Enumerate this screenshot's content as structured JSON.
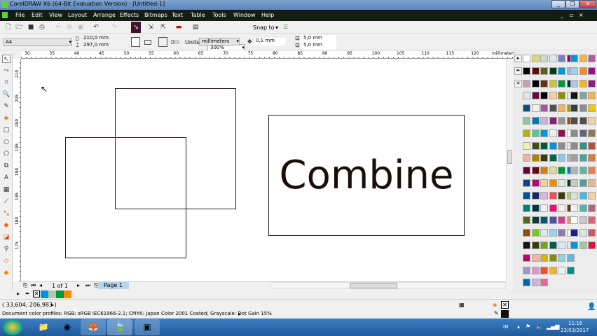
{
  "window": {
    "title": "CorelDRAW X6 (64-Bit Evaluation Version) - [Untitled-1]"
  },
  "menu": [
    "File",
    "Edit",
    "View",
    "Layout",
    "Arrange",
    "Effects",
    "Bitmaps",
    "Text",
    "Table",
    "Tools",
    "Window",
    "Help"
  ],
  "toolbar": {
    "zoom": "300%",
    "snap_to": "Snap to"
  },
  "property_bar": {
    "page_size": "A4",
    "width": "210,0 mm",
    "height": "297,0 mm",
    "units_label": "Units:",
    "units": "millimeters",
    "nudge": "0,1 mm",
    "dup_x": "5,0 mm",
    "dup_y": "5,0 mm"
  },
  "ruler": {
    "h_labels": [
      "30",
      "35",
      "40",
      "45",
      "50",
      "55",
      "60",
      "65",
      "70",
      "75",
      "80",
      "85",
      "90",
      "95",
      "100",
      "105",
      "110",
      "115",
      "120"
    ],
    "unit": "millimeters",
    "v_labels": [
      "210",
      "205",
      "200",
      "195",
      "190",
      "185",
      "180",
      "175"
    ]
  },
  "canvas": {
    "text": "Combine"
  },
  "page_nav": {
    "count": "1 of 1",
    "tab": "Page 1"
  },
  "doc_palette": [
    "#0096dc",
    "#b4c8a0",
    "#00963c",
    "#f08c00"
  ],
  "palette": [
    "#ffffff",
    "#dcd87a",
    "#c8dcc8",
    "#dce8f0",
    "#7882c0",
    "#8c0a6e",
    "#000000",
    "#5a0a0a",
    "#5a6414",
    "#003c14",
    "#0096dc",
    "#a0b4dc",
    "#c8a0b4",
    "#000000",
    "#643214",
    "#c8c83c",
    "#00963c",
    "#003250",
    "#dce8f0",
    "#640a3c",
    "#000000",
    "#f0d2a0",
    "#8c8c00",
    "#dcecf0",
    "#0a5078",
    "#f0f0f0",
    "#a05aa0",
    "#505050",
    "#f0b464",
    "#a0a000",
    "#8cc8a0",
    "#0078b4",
    "#c8b4dc",
    "#8c1e78",
    "#969696",
    "#a05000",
    "#b4b400",
    "#50c896",
    "#0096dc",
    "#f0f0f0",
    "#960a50",
    "#ffffff",
    "#f0f0b4",
    "#3c5014",
    "#005a3c",
    "#0096dc",
    "#8c8c8c",
    "#dce8f0",
    "#f0b4a0",
    "#b48200",
    "#3c3c14",
    "#006450",
    "#8cc8f0",
    "#b4b4b4",
    "#5a0a32",
    "#640a0a",
    "#d28214",
    "#dcdca0",
    "#00963c",
    "#0078c8",
    "#1e3c8c",
    "#b40a78",
    "#f0d2a0",
    "#f08c00",
    "#dce8dc",
    "#003c14",
    "#0050a0",
    "#142864",
    "#dcb4dc",
    "#f05050",
    "#3c3c14",
    "#b4c864",
    "#00826e",
    "#003250",
    "#f0f0f0",
    "#f00a78",
    "#f0f0f0",
    "#643c0a",
    "#5a6414",
    "#0a3c3c",
    "#0a5078",
    "#5050a0",
    "#d23c8c",
    "#f08c78",
    "#8c5000",
    "#78c81e",
    "#dce8f0",
    "#a0d2f0",
    "#8c78b4",
    "#f0f0f0",
    "#141414",
    "#3c3c0a",
    "#78a028",
    "#005a50",
    "#dce8f0",
    "#dce8f0",
    "#b40a5a",
    "#f0b4a0",
    "#dcb400",
    "#828c14",
    "#8cd2dc",
    "#64b4e6",
    "#a096c8",
    "#dc96c8",
    "#f05028",
    "#f0b428",
    "#f0f0f0",
    "#008c8c",
    "#0064b4",
    "#c8b4dc",
    "#e664a0"
  ],
  "palette2": [
    "#0096dc",
    "#f0b450",
    "#b45aa0",
    "#a0d2f0",
    "#f08c28",
    "#a00a8c",
    "#b4c8dc",
    "#f0b428",
    "#8c1e8c",
    "#141414",
    "#8ca0a0",
    "#f0b450",
    "#3c3c3c",
    "#8c8c8c",
    "#f0c800",
    "#505050",
    "#505050",
    "#f0d2a0",
    "#8c8c8c",
    "#646478",
    "#8c785a",
    "#8c8c8c",
    "#3c8c8c",
    "#b4503c",
    "#a0a0a0",
    "#50a0a0",
    "#d2823c",
    "#b4b4b4",
    "#64b4a0",
    "#e6825a",
    "#c8c8c8",
    "#50a096",
    "#f0b48c",
    "#dcdcdc",
    "#50b4dc",
    "#f0d2a0",
    "#f0f0f0",
    "#50b4b4",
    "#b46478",
    "#ffffff",
    "#c8c8c8",
    "#dc6478",
    "#1e1e8c",
    "#dce8dc",
    "#dc5064",
    "#0096dc",
    "#a0c8a0",
    "#f00a3c"
  ],
  "status": {
    "coords": "( 33,604; 206,983 )",
    "profiles": "Document color profiles: RGB: sRGB IEC61966-2.1; CMYK: Japan Color 2001 Coated; Grayscale: Dot Gain 15%"
  },
  "taskbar": {
    "lang": "IN",
    "time": "11:16",
    "date": "23/03/2017"
  }
}
